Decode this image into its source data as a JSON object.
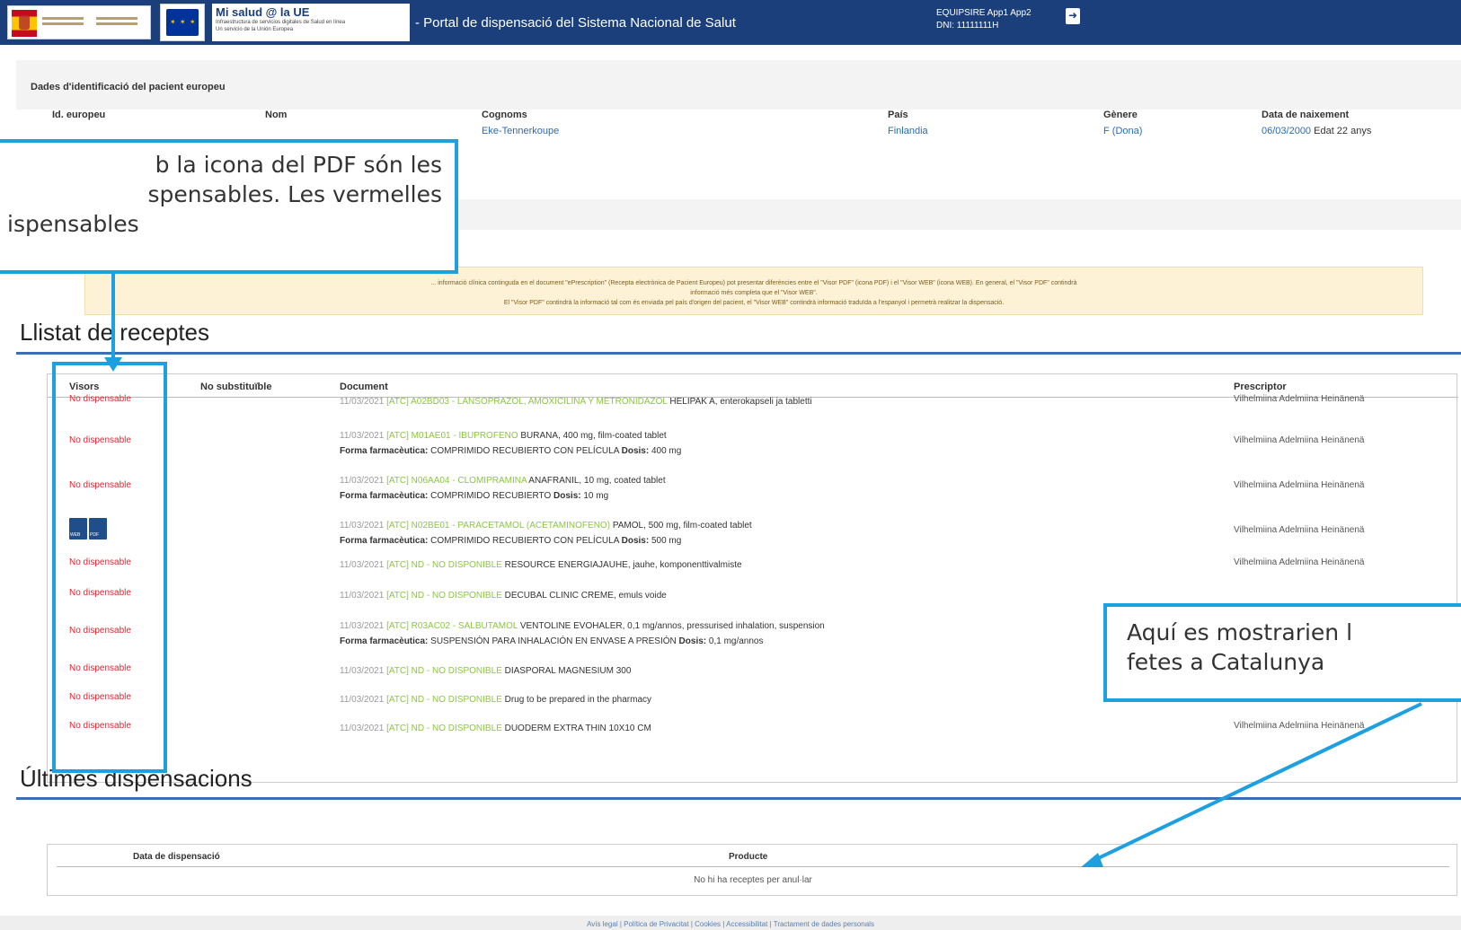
{
  "header": {
    "app_name": "Mi salud @ la UE",
    "app_subtitle_1": "Infraestructura de servicios digitales de Salud en línea",
    "app_subtitle_2": "Un servicio de la Unión Europea",
    "portal_title": "- Portal de dispensació del Sistema Nacional de Salut",
    "user_line_1": "EQUIPSIRE App1 App2",
    "user_line_2": "DNI: 11111111H"
  },
  "patient": {
    "section_title": "Dades d'identificació del pacient europeu",
    "columns": [
      {
        "label": "Id. europeu",
        "value": ""
      },
      {
        "label": "Nom",
        "value": ""
      },
      {
        "label": "Cognoms",
        "value": "Eke-Tennerkoupe"
      },
      {
        "label": "País",
        "value": "Finlandia"
      },
      {
        "label": "Gènere",
        "value": "F (Dona)"
      },
      {
        "label": "Data de naixement",
        "value": "06/03/2000",
        "age": "Edat 22 anys"
      }
    ]
  },
  "info_banner": {
    "line1": "... informació clínica continguda en el document \"ePrescription\" (Recepta electrònica de Pacient Europeu) pot presentar diferències entre el \"Visor PDF\" (icona PDF) i el \"Visor WEB\" (icona WEB). En general, el \"Visor PDF\" contindrà",
    "line2": "informació més completa que el \"Visor WEB\".",
    "line3": "El \"Visor PDF\" contindrà la informació tal com és enviada pel país d'origen del pacient, el \"Visor WEB\" contindrà informació traduïda a l'espanyol i permetrà realitzar la dispensació."
  },
  "recipes": {
    "heading": "Llistat de receptes",
    "col_state": "Visors",
    "col_no_subst": "No substituïble",
    "col_document": "Document",
    "col_prescriber": "Prescriptor",
    "not_dispensable": "No dispensable",
    "icon_web_label": "WEB",
    "icon_pdf_label": "PDF",
    "form_label": "Forma farmacèutica:",
    "dose_label": "Dosis:",
    "rows": [
      {
        "dispensable": false,
        "date": "11/03/2021",
        "atc": "[ATC] A02BD03 - LANSOPRAZOL, AMOXICILINA Y METRONIDAZOL",
        "name": "HELIPAK A, enterokapseli ja tabletti",
        "form": "",
        "dose": "",
        "prescriber": "Vilhelmiina Adelmiina Heinänenä"
      },
      {
        "dispensable": false,
        "date": "11/03/2021",
        "atc": "[ATC] M01AE01 - IBUPROFENO",
        "name": "BURANA, 400 mg, film-coated tablet",
        "form": "COMPRIMIDO RECUBIERTO CON PELÍCULA",
        "dose": "400 mg",
        "prescriber": "Vilhelmiina Adelmiina Heinänenä"
      },
      {
        "dispensable": false,
        "date": "11/03/2021",
        "atc": "[ATC] N06AA04 - CLOMIPRAMINA",
        "name": "ANAFRANIL, 10 mg, coated tablet",
        "form": "COMPRIMIDO RECUBIERTO",
        "dose": "10 mg",
        "prescriber": "Vilhelmiina Adelmiina Heinänenä"
      },
      {
        "dispensable": true,
        "date": "11/03/2021",
        "atc": "[ATC] N02BE01 - PARACETAMOL (ACETAMINOFENO)",
        "name": "PAMOL, 500 mg, film-coated tablet",
        "form": "COMPRIMIDO RECUBIERTO CON PELÍCULA",
        "dose": "500 mg",
        "prescriber": "Vilhelmiina Adelmiina Heinänenä"
      },
      {
        "dispensable": false,
        "date": "11/03/2021",
        "atc": "[ATC] ND - NO DISPONIBLE",
        "name": "RESOURCE ENERGIAJAUHE, jauhe, komponenttivalmiste",
        "form": "",
        "dose": "",
        "prescriber": "Vilhelmiina Adelmiina Heinänenä"
      },
      {
        "dispensable": false,
        "date": "11/03/2021",
        "atc": "[ATC] ND - NO DISPONIBLE",
        "name": "DECUBAL CLINIC CREME, emuls voide",
        "form": "",
        "dose": "",
        "prescriber": ""
      },
      {
        "dispensable": false,
        "date": "11/03/2021",
        "atc": "[ATC] R03AC02 - SALBUTAMOL",
        "name": "VENTOLINE EVOHALER, 0,1 mg/annos, pressurised inhalation, suspension",
        "form": "SUSPENSIÓN PARA INHALACIÓN EN ENVASE A PRESIÓN",
        "dose": "0,1 mg/annos",
        "prescriber": ""
      },
      {
        "dispensable": false,
        "date": "11/03/2021",
        "atc": "[ATC] ND - NO DISPONIBLE",
        "name": "DIASPORAL MAGNESIUM 300",
        "form": "",
        "dose": "",
        "prescriber": ""
      },
      {
        "dispensable": false,
        "date": "11/03/2021",
        "atc": "[ATC] ND - NO DISPONIBLE",
        "name": "Drug to be prepared in the pharmacy",
        "form": "",
        "dose": "",
        "prescriber": "Vilhelmiina Adelmiina Heinänenä"
      },
      {
        "dispensable": false,
        "date": "11/03/2021",
        "atc": "[ATC] ND - NO DISPONIBLE",
        "name": "DUODERM EXTRA THIN 10X10 CM",
        "form": "",
        "dose": "",
        "prescriber": "Vilhelmiina Adelmiina Heinänenä"
      }
    ]
  },
  "dispensations": {
    "heading": "Últimes dispensacions",
    "col_date": "Data de dispensació",
    "col_product": "Producte",
    "empty": "No hi ha receptes per anul·lar"
  },
  "footer": "Avís legal | Política de Privacitat | Cookies | Accessibilitat | Tractament de dades personals",
  "callouts": {
    "left_line1": "b la icona del PDF són les",
    "left_line2": "spensables. Les vermelles",
    "left_line3": "ispensables",
    "right_line1": "Aquí es mostrarien l",
    "right_line2": "fetes a Catalunya"
  },
  "colors": {
    "header_bg": "#1b3f7a",
    "callout_blue": "#1ca0e0",
    "not_dispensable_red": "#e0242b",
    "atc_green": "#8cc63f",
    "link_blue": "#2b6cb0"
  }
}
